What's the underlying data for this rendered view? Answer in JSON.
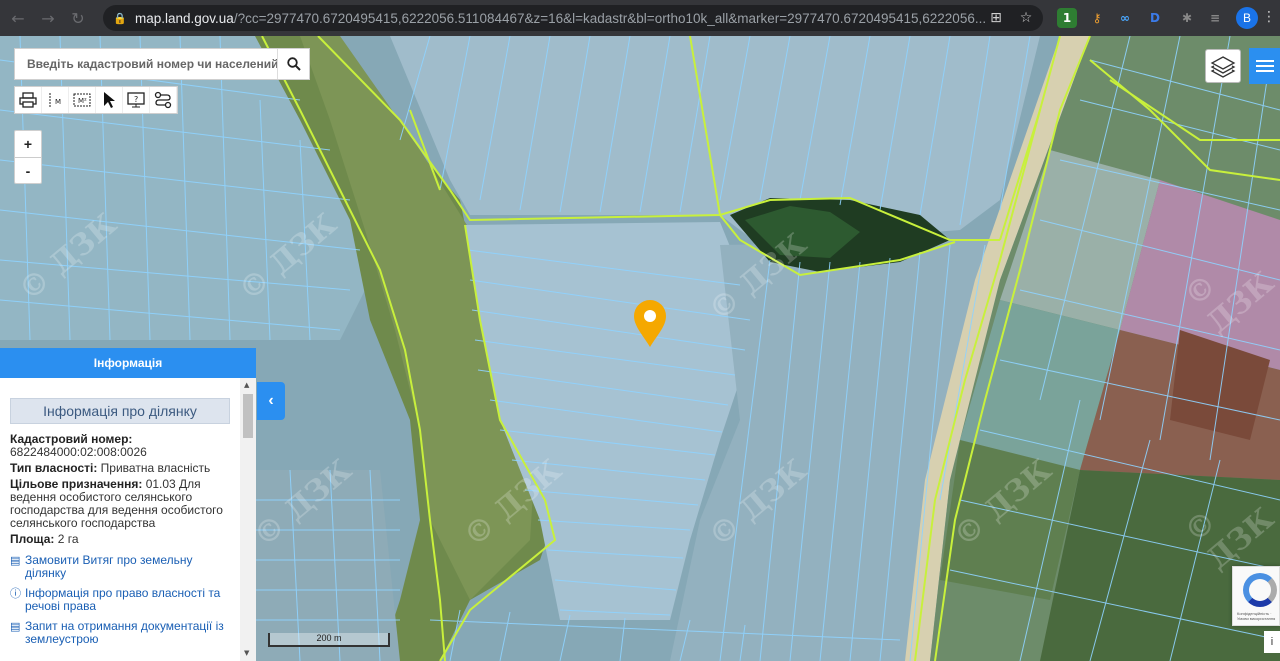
{
  "browser": {
    "url_host": "map.land.gov.ua",
    "url_rest": "/?cc=2977470.6720495415,6222056.511084467&z=16&l=kadastr&bl=ortho10k_all&marker=2977470.6720495415,6222056....",
    "profile_initial": "B",
    "ext_badge": "1"
  },
  "search": {
    "placeholder": "Введіть кадастровий номер чи населений"
  },
  "toolbar": {
    "tools": [
      "print-icon",
      "measure-line-icon",
      "measure-area-icon",
      "select-arrow-icon",
      "info-screen-icon",
      "route-icon"
    ]
  },
  "zoom": {
    "in_label": "+",
    "out_label": "-"
  },
  "watermark": "© ДЗК",
  "info_panel": {
    "header": "Інформація",
    "title": "Інформація про ділянку",
    "cadastral_label": "Кадастровий номер:",
    "cadastral_value": "6822484000:02:008:0026",
    "ownership_label": "Тип власності:",
    "ownership_value": "Приватна власність",
    "purpose_label": "Цільове призначення:",
    "purpose_value": "01.03 Для ведення особистого селянського господарства для ведення особистого селянського господарства",
    "area_label": "Площа:",
    "area_value": "2 га",
    "links": [
      {
        "icon": "document-icon",
        "text": "Замовити Витяг про земельну ділянку"
      },
      {
        "icon": "info-icon",
        "text": "Інформація про право власності та речові права"
      },
      {
        "icon": "document-icon",
        "text": "Запит на отримання документації із землеустрою"
      }
    ]
  },
  "scale": {
    "label": "200 m"
  },
  "recaptcha": {
    "text": "Конфіденційність · Умови використання"
  },
  "colors": {
    "accent": "#2b8ff0",
    "parcel_line": "#8fd3ff",
    "boundary_line": "#c8f03c",
    "marker": "#f5a800"
  }
}
